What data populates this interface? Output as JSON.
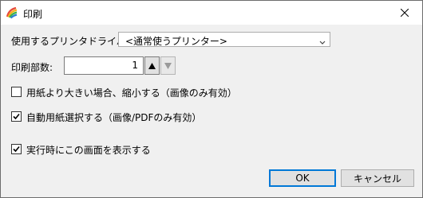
{
  "window": {
    "title": "印刷",
    "app_icon": "app-logo-icon",
    "close_icon": "close-icon"
  },
  "printer": {
    "label": "使用するプリンタドライバー:",
    "selected": "<通常使うプリンター>"
  },
  "copies": {
    "label": "印刷部数:",
    "value": "1",
    "up_icon": "triangle-up-icon",
    "down_icon": "triangle-down-icon"
  },
  "options": [
    {
      "label": "用紙より大きい場合、縮小する（画像のみ有効）",
      "checked": false
    },
    {
      "label": "自動用紙選択する（画像/PDFのみ有効）",
      "checked": true
    },
    {
      "label": "実行時にこの画面を表示する",
      "checked": true
    }
  ],
  "buttons": {
    "ok": "OK",
    "cancel": "キャンセル"
  }
}
